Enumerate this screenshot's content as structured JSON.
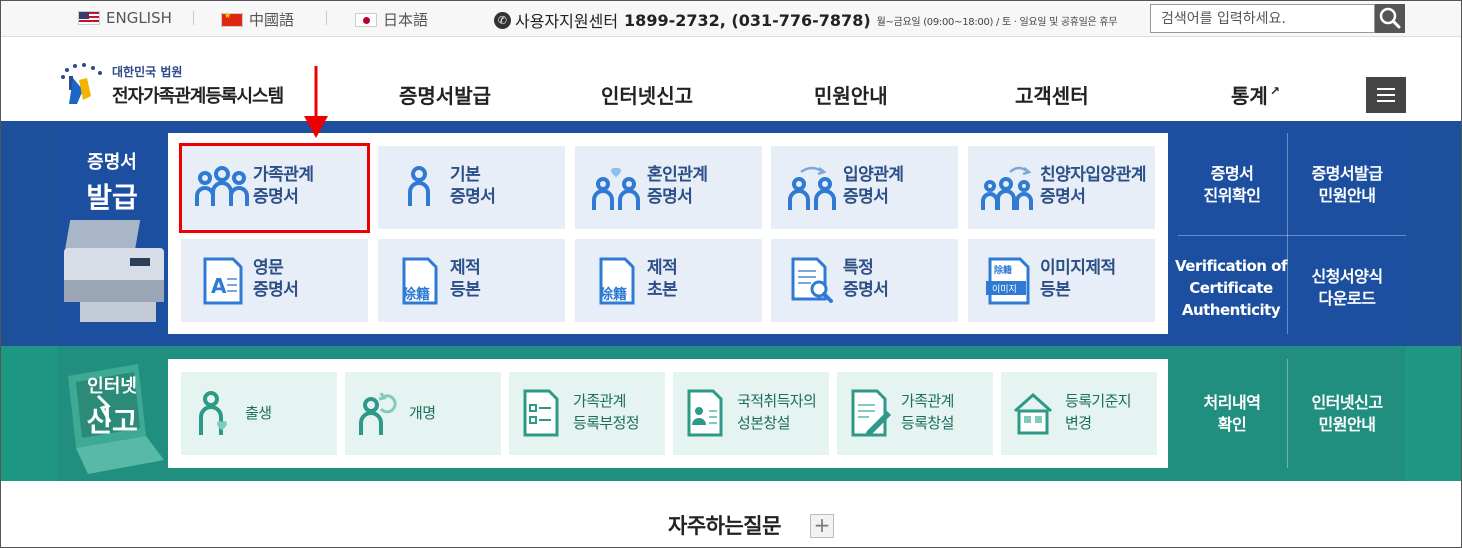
{
  "topbar": {
    "languages": [
      {
        "label": "ENGLISH",
        "flag": "us-flag-icon"
      },
      {
        "label": "中國語",
        "flag": "china-flag-icon"
      },
      {
        "label": "日本語",
        "flag": "japan-flag-icon"
      }
    ],
    "support_label": "사용자지원센터",
    "support_phone": "1899-2732, (031-776-7878)",
    "support_hours": "월~금요일 (09:00~18:00) / 토 · 일요일 및 공휴일은 휴무",
    "search_placeholder": "검색어를 입력하세요."
  },
  "header": {
    "logo_sub": "대한민국 법원",
    "logo_main": "전자가족관계등록시스템",
    "nav": [
      "증명서발급",
      "인터넷신고",
      "민원안내",
      "고객센터",
      "통계"
    ]
  },
  "certificates": {
    "label_small": "증명서",
    "label_big": "발급",
    "tiles": [
      {
        "line1": "가족관계",
        "line2": "증명서"
      },
      {
        "line1": "기본",
        "line2": "증명서"
      },
      {
        "line1": "혼인관계",
        "line2": "증명서"
      },
      {
        "line1": "입양관계",
        "line2": "증명서"
      },
      {
        "line1": "친양자입양관계",
        "line2": "증명서"
      },
      {
        "line1": "영문",
        "line2": "증명서"
      },
      {
        "line1": "제적",
        "line2": "등본"
      },
      {
        "line1": "제적",
        "line2": "초본"
      },
      {
        "line1": "특정",
        "line2": "증명서"
      },
      {
        "line1": "이미지제적",
        "line2": "등본"
      }
    ],
    "icon_texts": {
      "remove_register": "除籍",
      "image": "이미지",
      "remove_small": "除籍"
    },
    "side_links": [
      {
        "line1": "증명서",
        "line2": "진위확인",
        "line3": ""
      },
      {
        "line1": "증명서발급",
        "line2": "민원안내",
        "line3": ""
      },
      {
        "line1": "Verification of",
        "line2": "Certificate",
        "line3": "Authenticity"
      },
      {
        "line1": "신청서양식",
        "line2": "다운로드",
        "line3": ""
      }
    ]
  },
  "internet_report": {
    "label_small": "인터넷",
    "label_big": "신고",
    "tiles": [
      {
        "line1": "출생",
        "line2": ""
      },
      {
        "line1": "개명",
        "line2": ""
      },
      {
        "line1": "가족관계",
        "line2": "등록부정정"
      },
      {
        "line1": "국적취득자의",
        "line2": "성본창설"
      },
      {
        "line1": "가족관계",
        "line2": "등록창설"
      },
      {
        "line1": "등록기준지",
        "line2": "변경"
      }
    ],
    "side_links": [
      {
        "line1": "처리내역",
        "line2": "확인"
      },
      {
        "line1": "인터넷신고",
        "line2": "민원안내"
      }
    ]
  },
  "faq": {
    "title": "자주하는질문",
    "plus": "+"
  },
  "colors": {
    "blue_band": "#1c4fa0",
    "green_band": "#218f7f",
    "highlight": "#ee0000"
  }
}
